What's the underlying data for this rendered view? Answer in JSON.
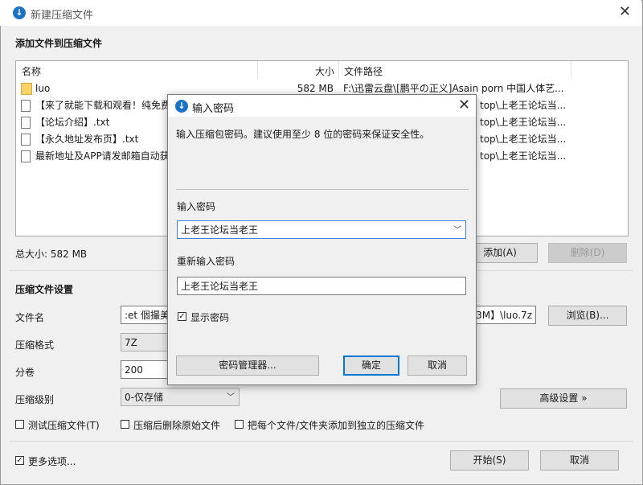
{
  "window": {
    "title": "新建压缩文件"
  },
  "add_files": {
    "header": "添加文件到压缩文件",
    "columns": {
      "name": "名称",
      "size": "大小",
      "path": "文件路径"
    },
    "rows": [
      {
        "icon": "folder-icon",
        "name": "luo",
        "size": "582 MB",
        "path": "F:\\迅雷云盘\\[鹏平の正义]Asain porn 中国人体艺..."
      },
      {
        "icon": "text-file-icon",
        "name": "【来了就能下载和观看！纯免费",
        "size": "",
        "path": "top\\上老王论坛当..."
      },
      {
        "icon": "text-file-icon",
        "name": "【论坛介绍】.txt",
        "size": "",
        "path": "top\\上老王论坛当..."
      },
      {
        "icon": "text-file-icon",
        "name": "【永久地址发布页】.txt",
        "size": "",
        "path": "top\\上老王论坛当..."
      },
      {
        "icon": "text-file-icon",
        "name": "最新地址及APP请发邮箱自动获",
        "size": "",
        "path": "top\\上老王论坛当..."
      }
    ],
    "total_size": "总大小: 582 MB",
    "add_label": "添加(A)",
    "delete_label": "删除(D)"
  },
  "settings": {
    "header": "压缩文件设置",
    "filename_label": "文件名",
    "filename_value": ":et 個撮美",
    "filename_tail": "3M】\\luo.7z",
    "browse_label": "浏览(B)...",
    "format_label": "压缩格式",
    "format_value": "7Z",
    "volume_label": "分卷",
    "volume_value": "200",
    "level_label": "压缩级别",
    "level_value": "0-仅存储",
    "advanced_label": "高级设置 »",
    "test_label": "测试压缩文件(T)",
    "delete_after_label": "压缩后删除原始文件",
    "separate_label": "把每个文件/文件夹添加到独立的压缩文件",
    "more_options_label": "更多选项...",
    "start_label": "开始(S)",
    "cancel_label": "取消"
  },
  "dialog": {
    "title": "输入密码",
    "hint": "输入压缩包密码。建议使用至少 8 位的密码来保证安全性。",
    "password_label": "输入密码",
    "password_value": "上老王论坛当老王",
    "reenter_label": "重新输入密码",
    "reenter_value": "上老王论坛当老王",
    "show_password_label": "显示密码",
    "show_password_checked": true,
    "manager_label": "密码管理器...",
    "ok_label": "确定",
    "cancel_label": "取消"
  },
  "accent_color": "#1a73c9"
}
